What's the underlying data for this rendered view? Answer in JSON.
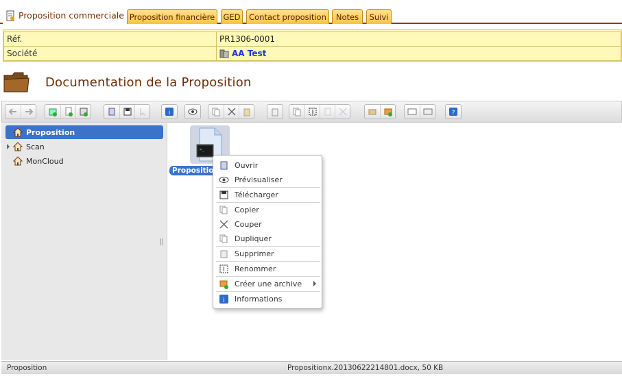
{
  "tabs": {
    "active": "Proposition commerciale",
    "items": [
      "Proposition financière",
      "GED",
      "Contact proposition",
      "Notes",
      "Suivi"
    ]
  },
  "info": {
    "ref_label": "Réf.",
    "ref_value": "PR1306-0001",
    "company_label": "Société",
    "company_value": "AA Test"
  },
  "page_title": "Documentation de la Proposition",
  "tree": {
    "items": [
      "Proposition",
      "Scan",
      "MonCloud"
    ],
    "selected": "Proposition"
  },
  "file": {
    "label": "Propositionx"
  },
  "context_menu": {
    "items": [
      "Ouvrir",
      "Prévisualiser",
      "Télécharger",
      "Copier",
      "Couper",
      "Dupliquer",
      "Supprimer",
      "Renommer",
      "Créer une archive",
      "Informations"
    ]
  },
  "status": {
    "left": "Proposition",
    "right": "Propositionx.20130622214801.docx, 50 KB"
  },
  "colors": {
    "accent": "#3c72c8",
    "tab_bg": "#f5c443",
    "info_bg": "#fef9b8",
    "title": "#6e2d06"
  }
}
